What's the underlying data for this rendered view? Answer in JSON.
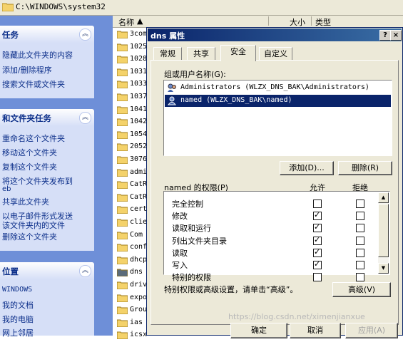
{
  "address": {
    "path": "C:\\WINDOWS\\system32"
  },
  "tasks": {
    "panels": [
      {
        "title": "任务",
        "items": [
          "隐藏此文件夹的内容",
          "添加/删除程序",
          "搜索文件或文件夹"
        ]
      },
      {
        "title": "和文件夹任务",
        "items": [
          "重命名这个文件夹",
          "移动这个文件夹",
          "复制这个文件夹",
          "将这个文件夹发布到",
          "eb",
          "共享此文件夹",
          "以电子邮件形式发送",
          "该文件夹内的文件",
          "删除这个文件夹"
        ]
      },
      {
        "title": "位置",
        "items": [
          "WINDOWS",
          "我的文档",
          "我的电脑",
          "网上邻居"
        ]
      }
    ]
  },
  "filelist": {
    "columns": {
      "name": "名称",
      "size": "大小",
      "type": "类型"
    },
    "rows": [
      "3com",
      "1025",
      "1028",
      "1031",
      "1033",
      "1037",
      "1041",
      "1042",
      "1054",
      "2052",
      "3076",
      "admi",
      "CatR",
      "CatR",
      "cert",
      "clie",
      "Com",
      "conf",
      "dhcp",
      "dns",
      "driv",
      "expo",
      "Grou",
      "ias",
      "icsx"
    ]
  },
  "dialog": {
    "title": "dns 属性",
    "help_label": "?",
    "close_label": "×",
    "tabs": [
      "常规",
      "共享",
      "安全",
      "自定义"
    ],
    "group_label": "组或用户名称(G):",
    "users": [
      "Administrators (WLZX_DNS_BAK\\Administrators)",
      "named (WLZX_DNS_BAK\\named)"
    ],
    "add_button": "添加(D)...",
    "remove_button": "删除(R)",
    "perm_label": "named 的权限(P)",
    "allow_header": "允许",
    "deny_header": "拒绝",
    "permissions": [
      {
        "name": "完全控制",
        "allow": false,
        "deny": false
      },
      {
        "name": "修改",
        "allow": true,
        "deny": false
      },
      {
        "name": "读取和运行",
        "allow": true,
        "deny": false
      },
      {
        "name": "列出文件夹目录",
        "allow": true,
        "deny": false
      },
      {
        "name": "读取",
        "allow": true,
        "deny": false
      },
      {
        "name": "写入",
        "allow": true,
        "deny": false
      },
      {
        "name": "特别的权限",
        "allow": false,
        "deny": false
      }
    ],
    "advanced_hint": "特别权限或高级设置，请单击“高级”。",
    "advanced_button": "高级(V)",
    "ok_button": "确定",
    "cancel_button": "取消",
    "apply_button": "应用(A)"
  },
  "watermark": "https://blog.csdn.net/ximenjianxue"
}
